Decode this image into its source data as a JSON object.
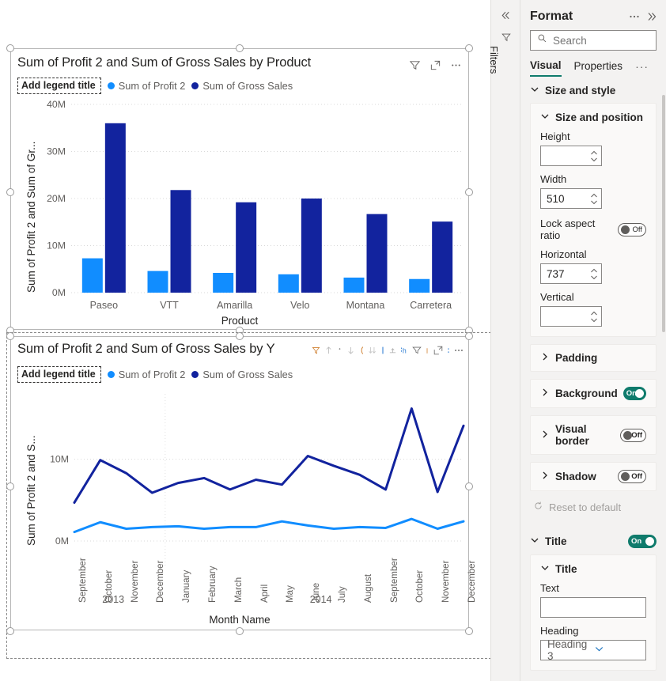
{
  "canvas": {
    "bar_visual": {
      "title": "Sum of Profit 2 and Sum of Gross Sales by Product",
      "legend_title_placeholder": "Add legend title",
      "legend": [
        {
          "label": "Sum of Profit 2",
          "color": "#118DFF"
        },
        {
          "label": "Sum of Gross Sales",
          "color": "#12239E"
        }
      ],
      "icons": [
        "filter-icon",
        "focus-mode-icon",
        "more-options-icon"
      ]
    },
    "line_visual": {
      "title": "Sum of Profit 2 and Sum of Gross Sales by Y",
      "legend_title_placeholder": "Add legend title",
      "legend": [
        {
          "label": "Sum of Profit 2",
          "color": "#118DFF"
        },
        {
          "label": "Sum of Gross Sales",
          "color": "#12239E"
        }
      ],
      "toolbar_icons": [
        "sort-icon",
        "sort-ascending-icon",
        "sort-descending-icon",
        "sort-az-icon",
        "sort-za-icon",
        "drill-down-icon",
        "drill-up-icon",
        "expand-hierarchy-icon",
        "filter-icon",
        "focus-mode-icon",
        "more-options-icon"
      ]
    }
  },
  "chart_data": [
    {
      "type": "bar",
      "title": "Sum of Profit 2 and Sum of Gross Sales by Product",
      "xlabel": "Product",
      "ylabel": "Sum of Profit 2 and Sum of Gr...",
      "categories": [
        "Paseo",
        "VTT",
        "Amarilla",
        "Velo",
        "Montana",
        "Carretera"
      ],
      "ylim": [
        0,
        40000000
      ],
      "yticks": [
        "0M",
        "10M",
        "20M",
        "30M",
        "40M"
      ],
      "ytick_values": [
        0,
        10000000,
        20000000,
        30000000,
        40000000
      ],
      "grid": true,
      "legend_position": "top",
      "series": [
        {
          "name": "Sum of Profit 2",
          "color": "#118DFF",
          "values": [
            7300000,
            4600000,
            4200000,
            3900000,
            3200000,
            2900000
          ]
        },
        {
          "name": "Sum of Gross Sales",
          "color": "#12239E",
          "values": [
            36000000,
            21800000,
            19200000,
            20000000,
            16700000,
            15100000
          ]
        }
      ]
    },
    {
      "type": "line",
      "title": "Sum of Profit 2 and Sum of Gross Sales by Y",
      "xlabel": "Month Name",
      "ylabel": "Sum of Profit 2 and S...",
      "ylim": [
        0,
        18000000
      ],
      "yticks": [
        "0M",
        "10M"
      ],
      "ytick_values": [
        0,
        10000000
      ],
      "grid": true,
      "legend_position": "top",
      "x": [
        "September",
        "October",
        "November",
        "December",
        "January",
        "February",
        "March",
        "April",
        "May",
        "June",
        "July",
        "August",
        "September",
        "October",
        "November",
        "December"
      ],
      "x_groups": [
        {
          "label": "2013",
          "count": 4
        },
        {
          "label": "2014",
          "count": 12
        }
      ],
      "series": [
        {
          "name": "Sum of Profit 2",
          "color": "#118DFF",
          "values": [
            1100000,
            2300000,
            1500000,
            1700000,
            1800000,
            1500000,
            1700000,
            1700000,
            2400000,
            1900000,
            1500000,
            1700000,
            1600000,
            2700000,
            1500000,
            2400000
          ]
        },
        {
          "name": "Sum of Gross Sales",
          "color": "#12239E",
          "values": [
            4700000,
            9900000,
            8300000,
            5900000,
            7100000,
            7700000,
            6300000,
            7500000,
            6900000,
            10400000,
            9200000,
            8100000,
            6300000,
            16200000,
            6000000,
            14100000
          ]
        }
      ]
    }
  ],
  "filters_pane": {
    "label": "Filters",
    "collapse_icon": "chevron-double-left-icon",
    "filter_icon": "filter-icon"
  },
  "format_pane": {
    "title": "Format",
    "more_icon": "more-options-icon",
    "expand_icon": "chevron-double-right-icon",
    "search": {
      "placeholder": "Search",
      "value": "",
      "icon": "search-icon"
    },
    "tabs": [
      {
        "label": "Visual",
        "active": true
      },
      {
        "label": "Properties",
        "active": false
      }
    ],
    "tabs_more": "···",
    "sections": [
      {
        "name": "size-and-style",
        "label": "Size and style",
        "expanded": true,
        "cards": [
          {
            "name": "size-and-position",
            "label": "Size and position",
            "expanded": true,
            "fields": [
              {
                "name": "height",
                "label": "Height",
                "value": ""
              },
              {
                "name": "width",
                "label": "Width",
                "value": "510"
              },
              {
                "name": "lock-aspect-ratio",
                "label": "Lock aspect ratio",
                "toggle": "Off"
              },
              {
                "name": "horizontal",
                "label": "Horizontal",
                "value": "737"
              },
              {
                "name": "vertical",
                "label": "Vertical",
                "value": ""
              }
            ]
          },
          {
            "name": "padding",
            "label": "Padding",
            "expanded": false
          },
          {
            "name": "background",
            "label": "Background",
            "expanded": false,
            "toggle": "On"
          },
          {
            "name": "visual-border",
            "label": "Visual border",
            "expanded": false,
            "toggle": "Off"
          },
          {
            "name": "shadow",
            "label": "Shadow",
            "expanded": false,
            "toggle": "Off"
          }
        ],
        "reset": "Reset to default"
      },
      {
        "name": "title",
        "label": "Title",
        "expanded": true,
        "toggle": "On",
        "cards": [
          {
            "name": "title",
            "label": "Title",
            "expanded": true,
            "fields": [
              {
                "name": "text",
                "label": "Text",
                "value": ""
              },
              {
                "name": "heading",
                "label": "Heading",
                "value": "Heading 3"
              }
            ]
          }
        ]
      }
    ]
  }
}
